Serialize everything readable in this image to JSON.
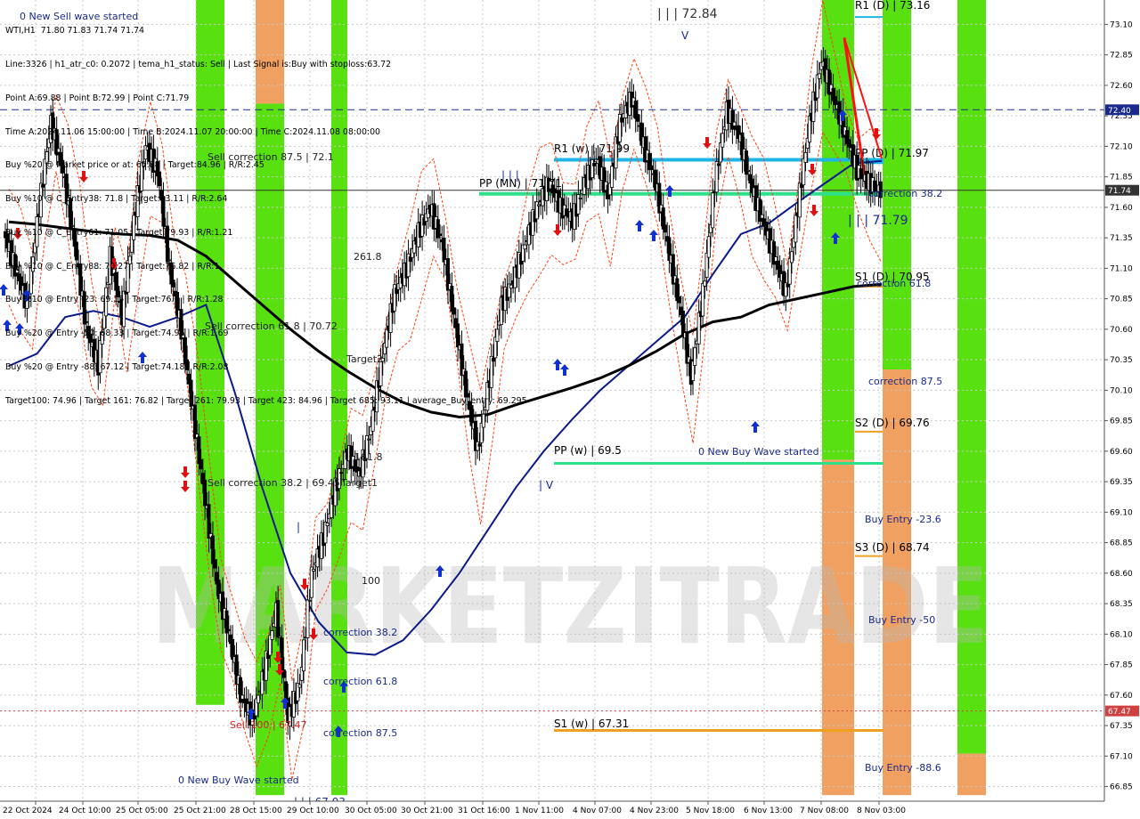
{
  "header": {
    "info_lines": [
      "WTI,H1  71.80 71.83 71.74 71.74",
      "Line:3326 | h1_atr_c0: 0.2072 | tema_h1_status: Sell | Last Signal is:Buy with stoploss:63.72",
      "Point A:69.88 | Point B:72.99 | Point C:71.79",
      "Time A:2024.11.06 15:00:00 | Time B:2024.11.07 20:00:00 | Time C:2024.11.08 08:00:00",
      "Buy %20 @ Market price or at: 69.88 | Target:84.96 | R/R:2.45",
      "Buy %10 @ C_Entry38: 71.8 | Target:93.11 | R/R:2.64",
      "Buy %10 @ C_Entry61: 71.05 | Target:79.93 | R/R:1.21",
      "Buy %10 @ C_Entry88: 70.27 | Target:76.82 | R/R:1",
      "Buy %10 @ Entry -23: 69.15 | Target:76.1 | R/R:1.28",
      "Buy %20 @ Entry -50: 68.33 | Target:74.96 | R/R:1.69",
      "Buy %20 @ Entry -88: 67.12 | Target:74.18 | R/R:2.08",
      "Target100: 74.96 | Target 161: 76.82 | Target 261: 79.93 | Target 423: 84.96 | Target 685: 93.11 | average_Buy_entry: 69.295"
    ],
    "wave_note": "0 New Sell wave started"
  },
  "watermark": "MARKETZITRADE",
  "price_axis": {
    "min": 66.73,
    "max": 73.3,
    "ticks": [
      "73.10",
      "72.85",
      "72.60",
      "72.35",
      "72.10",
      "71.85",
      "71.60",
      "71.35",
      "71.10",
      "70.85",
      "70.60",
      "70.35",
      "70.10",
      "69.85",
      "69.60",
      "69.35",
      "69.10",
      "68.85",
      "68.60",
      "68.35",
      "68.10",
      "67.85",
      "67.60",
      "67.35",
      "67.10",
      "66.85"
    ],
    "badges": [
      {
        "price": 72.4,
        "label": "72.40",
        "color": "#1a2a8c",
        "line_style": "dash"
      },
      {
        "price": 71.74,
        "label": "71.74",
        "color": "#333333",
        "line_style": "solid"
      },
      {
        "price": 67.47,
        "label": "67.47",
        "color": "#d04040",
        "line_style": "dot"
      }
    ]
  },
  "time_axis": {
    "labels": [
      "22 Oct 2024",
      "24 Oct 10:00",
      "25 Oct 05:00",
      "25 Oct 21:00",
      "28 Oct 15:00",
      "29 Oct 10:00",
      "30 Oct 05:00",
      "30 Oct 21:00",
      "31 Oct 16:00",
      "1 Nov 11:00",
      "4 Nov 07:00",
      "4 Nov 23:00",
      "5 Nov 18:00",
      "6 Nov 13:00",
      "7 Nov 08:00",
      "8 Nov 03:00"
    ]
  },
  "zones": [
    {
      "color": "#58e010",
      "price_top": 73.3,
      "price_bottom": 67.52
    },
    {
      "color": "#f0a060",
      "price_top": 73.3,
      "price_bottom": 72.45
    },
    {
      "color": "#58e010",
      "price_top": 72.45,
      "price_bottom": 66.78
    },
    {
      "color": "#58e010",
      "price_top": 73.3,
      "price_bottom": 66.78
    },
    {
      "color": "#58e010",
      "price_top": 73.3,
      "price_bottom": 69.53
    },
    {
      "color": "#f0a060",
      "price_top": 69.53,
      "price_bottom": 66.78
    },
    {
      "color": "#58e010",
      "price_top": 73.3,
      "price_bottom": 70.27
    },
    {
      "color": "#f0a060",
      "price_top": 70.27,
      "price_bottom": 66.78
    },
    {
      "color": "#58e010",
      "price_top": 73.3,
      "price_bottom": 67.12
    },
    {
      "color": "#f0a060",
      "price_top": 67.12,
      "price_bottom": 66.78
    }
  ],
  "levels": [
    {
      "label": "R1 (D) | 73.16",
      "price": 73.16,
      "color": "#1fb4e6",
      "label_color": "#000000"
    },
    {
      "label": "R1 (w) | 71.99",
      "price": 71.99,
      "color": "#1fb4e6",
      "label_color": "#000000"
    },
    {
      "label": "PP (D) | 71.97",
      "price": 71.97,
      "color": "#1fb4e6",
      "label_color": "#000000"
    },
    {
      "label": "PP (MN) | 71.71",
      "price": 71.71,
      "color": "#2ee08a",
      "label_color": "#000000"
    },
    {
      "label": "S1 (D) | 70.95",
      "price": 70.95,
      "color": "#f0a020",
      "label_color": "#000000"
    },
    {
      "label": "S2 (D) | 69.76",
      "price": 69.76,
      "color": "#f0a020",
      "label_color": "#000000"
    },
    {
      "label": "PP (w) | 69.5",
      "price": 69.5,
      "color": "#2ee08a",
      "label_color": "#000000"
    },
    {
      "label": "S3 (D) | 68.74",
      "price": 68.74,
      "color": "#f0a020",
      "label_color": "#000000"
    },
    {
      "label": "S1 (w) | 67.31",
      "price": 67.31,
      "color": "#f0a020",
      "label_color": "#000000"
    }
  ],
  "annotations": [
    {
      "text": "| | | 72.84",
      "color": "#333333",
      "size": 14
    },
    {
      "text": "V",
      "color": "#1a2a8c",
      "size": 12
    },
    {
      "text": "| | |",
      "color": "#1a2a8c",
      "size": 12
    },
    {
      "text": "| V",
      "color": "#1a2a8c",
      "size": 12
    },
    {
      "text": "|",
      "color": "#1a2a8c",
      "size": 12
    },
    {
      "text": "| | | 71.79",
      "color": "#1a2a8c",
      "size": 14
    },
    {
      "text": "Sell correction 87.5 | 72.1",
      "color": "#222222",
      "size": 11
    },
    {
      "text": "Sell correction 61.8 | 70.72",
      "color": "#222222",
      "size": 11
    },
    {
      "text": "Sell correction 38.2 | 69.45",
      "color": "#222222",
      "size": 11
    },
    {
      "text": "261.8",
      "color": "#222222",
      "size": 11
    },
    {
      "text": "Target2",
      "color": "#222222",
      "size": 11
    },
    {
      "text": "161.8",
      "color": "#222222",
      "size": 11
    },
    {
      "text": "Target1",
      "color": "#222222",
      "size": 11
    },
    {
      "text": "100",
      "color": "#222222",
      "size": 11
    },
    {
      "text": "Sell 100 | 67.47",
      "color": "#cc2020",
      "size": 11
    },
    {
      "text": "0 New Buy Wave started",
      "color": "#1a2a8c",
      "size": 11
    },
    {
      "text": "0 New Buy Wave started",
      "color": "#1a2a8c",
      "size": 11
    },
    {
      "text": "correction 38.2",
      "color": "#1a2a8c",
      "size": 11
    },
    {
      "text": "correction 61.8",
      "color": "#1a2a8c",
      "size": 11
    },
    {
      "text": "correction 87.5",
      "color": "#1a2a8c",
      "size": 11
    },
    {
      "text": "correction 38.2",
      "color": "#1a2a8c",
      "size": 11
    },
    {
      "text": "correction 61.8",
      "color": "#1a2a8c",
      "size": 11
    },
    {
      "text": "correction 87.5",
      "color": "#1a2a8c",
      "size": 11
    },
    {
      "text": "Buy Entry -23.6",
      "color": "#1a2a8c",
      "size": 11
    },
    {
      "text": "Buy Entry -50",
      "color": "#1a2a8c",
      "size": 11
    },
    {
      "text": "Buy Entry -88.6",
      "color": "#1a2a8c",
      "size": 11
    },
    {
      "text": "| | | 67.03",
      "color": "#1a2a8c",
      "size": 12
    }
  ],
  "chart_data": {
    "type": "candlestick",
    "symbol": "WTI",
    "timeframe": "H1",
    "last_price": 71.74,
    "ohlc_last": {
      "open": 71.8,
      "high": 71.83,
      "low": 71.74,
      "close": 71.74
    },
    "price_range": [
      66.73,
      73.3
    ],
    "overlays": {
      "ma_slow_color": "#000000",
      "ma_fast_color": "#0a1a8a",
      "channel_color": "#ff4010",
      "sell_leg_color": "#ff1010",
      "buy_arrow_color": "#1030d0",
      "sell_arrow_color": "#e01010",
      "slow_ma": [
        71.48,
        71.46,
        71.43,
        71.4,
        71.38,
        71.37,
        71.33,
        71.2,
        71.0,
        70.8,
        70.6,
        70.42,
        70.26,
        70.12,
        70.0,
        69.92,
        69.88,
        69.9,
        69.98,
        70.05,
        70.12,
        70.2,
        70.3,
        70.42,
        70.56,
        70.66,
        70.7,
        70.8,
        70.85,
        70.9,
        70.95,
        70.97
      ],
      "fast_ma": [
        70.3,
        70.4,
        70.7,
        70.75,
        70.7,
        70.62,
        70.7,
        70.8,
        70.1,
        69.3,
        68.6,
        68.2,
        67.95,
        67.93,
        68.05,
        68.3,
        68.6,
        68.95,
        69.3,
        69.6,
        69.86,
        70.1,
        70.3,
        70.5,
        70.7,
        71.05,
        71.38,
        71.47,
        71.64,
        71.8,
        71.96,
        71.98
      ]
    },
    "price_path": [
      71.4,
      71.1,
      70.8,
      71.6,
      72.3,
      71.9,
      71.3,
      70.6,
      70.3,
      71.2,
      70.7,
      71.5,
      72.1,
      71.9,
      71.1,
      70.6,
      69.9,
      69.2,
      68.5,
      68.1,
      67.6,
      67.4,
      67.8,
      68.3,
      67.4,
      67.7,
      68.6,
      68.9,
      69.3,
      69.6,
      69.4,
      69.8,
      70.4,
      70.9,
      71.1,
      71.4,
      71.6,
      71.3,
      70.7,
      70.1,
      69.6,
      70.2,
      70.8,
      71.0,
      71.3,
      71.6,
      71.8,
      71.6,
      71.5,
      71.8,
      72.0,
      71.7,
      72.3,
      72.5,
      72.1,
      71.8,
      71.3,
      70.8,
      70.2,
      70.9,
      71.8,
      72.4,
      72.2,
      71.8,
      71.5,
      71.2,
      70.9,
      71.6,
      72.3,
      72.8,
      72.5,
      72.2,
      71.9,
      71.8,
      71.74
    ]
  }
}
